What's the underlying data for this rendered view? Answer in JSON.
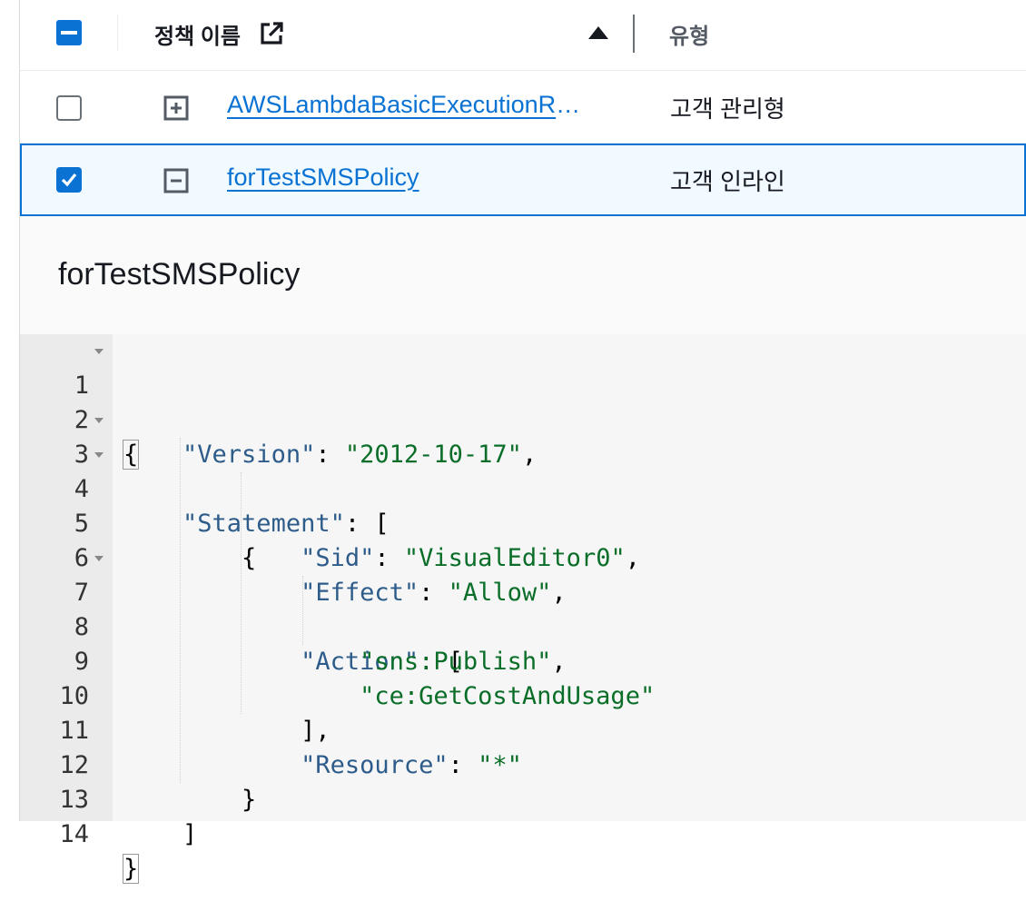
{
  "header": {
    "title": "정책 이름",
    "type_label": "유형"
  },
  "rows": [
    {
      "name": "AWSLambdaBasicExecutionRole",
      "type": "고객 관리형",
      "checked": false,
      "expanded": false
    },
    {
      "name": "forTestSMSPolicy",
      "type": "고객 인라인",
      "checked": true,
      "expanded": true
    }
  ],
  "detail": {
    "title": "forTestSMSPolicy",
    "lines": [
      {
        "n": "1",
        "fold": true
      },
      {
        "n": "2",
        "fold": false
      },
      {
        "n": "3",
        "fold": true
      },
      {
        "n": "4",
        "fold": true
      },
      {
        "n": "5",
        "fold": false
      },
      {
        "n": "6",
        "fold": false
      },
      {
        "n": "7",
        "fold": true
      },
      {
        "n": "8",
        "fold": false
      },
      {
        "n": "9",
        "fold": false
      },
      {
        "n": "10",
        "fold": false
      },
      {
        "n": "11",
        "fold": false
      },
      {
        "n": "12",
        "fold": false
      },
      {
        "n": "13",
        "fold": false
      },
      {
        "n": "14",
        "fold": false
      }
    ],
    "tokens": {
      "open_brace": "{",
      "close_brace": "}",
      "open_bracket": "[",
      "close_bracket": "]",
      "close_bracket_comma": "],",
      "colon": ": ",
      "comma": ",",
      "version_key": "\"Version\"",
      "version_val": "\"2012-10-17\"",
      "statement_key": "\"Statement\"",
      "sid_key": "\"Sid\"",
      "sid_val": "\"VisualEditor0\"",
      "effect_key": "\"Effect\"",
      "effect_val": "\"Allow\"",
      "action_key": "\"Action\"",
      "action_1": "\"sns:Publish\"",
      "action_2": "\"ce:GetCostAndUsage\"",
      "resource_key": "\"Resource\"",
      "resource_val": "\"*\""
    }
  },
  "colors": {
    "accent": "#0972d3",
    "json_key": "#2e5c8a",
    "json_value": "#0a6e29"
  }
}
